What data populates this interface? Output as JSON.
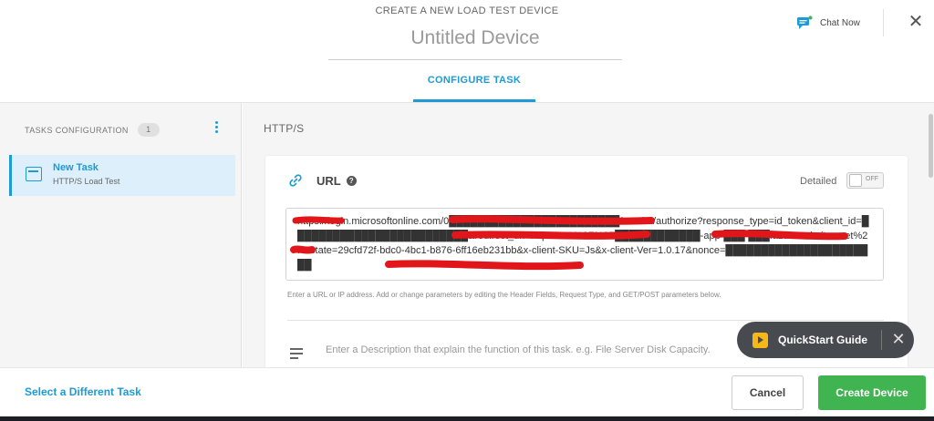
{
  "header": {
    "create_title": "CREATE A NEW LOAD TEST DEVICE",
    "device_name_placeholder": "Untitled Device",
    "tab_configure": "CONFIGURE TASK",
    "chat_label": "Chat Now",
    "close_glyph": "✕"
  },
  "sidebar": {
    "heading": "TASKS CONFIGURATION",
    "count": "1",
    "items": [
      {
        "title": "New Task",
        "subtitle": "HTTP/S Load Test",
        "icon": "browser-window-icon"
      }
    ]
  },
  "main": {
    "protocol_label": "HTTP/S",
    "url_section": {
      "title": "URL",
      "help_glyph": "?",
      "detailed_label": "Detailed",
      "toggle_state": "OFF",
      "url_text": "https://login.microsoftonline.com/0████████████████████████/oauth2/authorize?response_type=id_token&client_id=█████████████████████████&redirect_uri=https%3A%2F%2F████████████-app-███-███.azurewebsites.net%2F&state=29cfd72f-bdc0-4bc1-b876-6ff16eb231bb&x-client-SKU=Js&x-client-Ver=1.0.17&nonce=██████████████████████",
      "hint": "Enter a URL or IP address. Add or change parameters by editing the Header Fields, Request Type, and GET/POST parameters below."
    },
    "description_placeholder": "Enter a Description that explain the function of this task. e.g. File Server Disk Capacity."
  },
  "quickstart": {
    "label": "QuickStart Guide",
    "close_glyph": "✕"
  },
  "footer": {
    "select_different": "Select a Different Task",
    "cancel": "Cancel",
    "create": "Create Device"
  },
  "colors": {
    "accent": "#1e9ad6",
    "success": "#3fb450",
    "redaction": "#e0161b"
  }
}
